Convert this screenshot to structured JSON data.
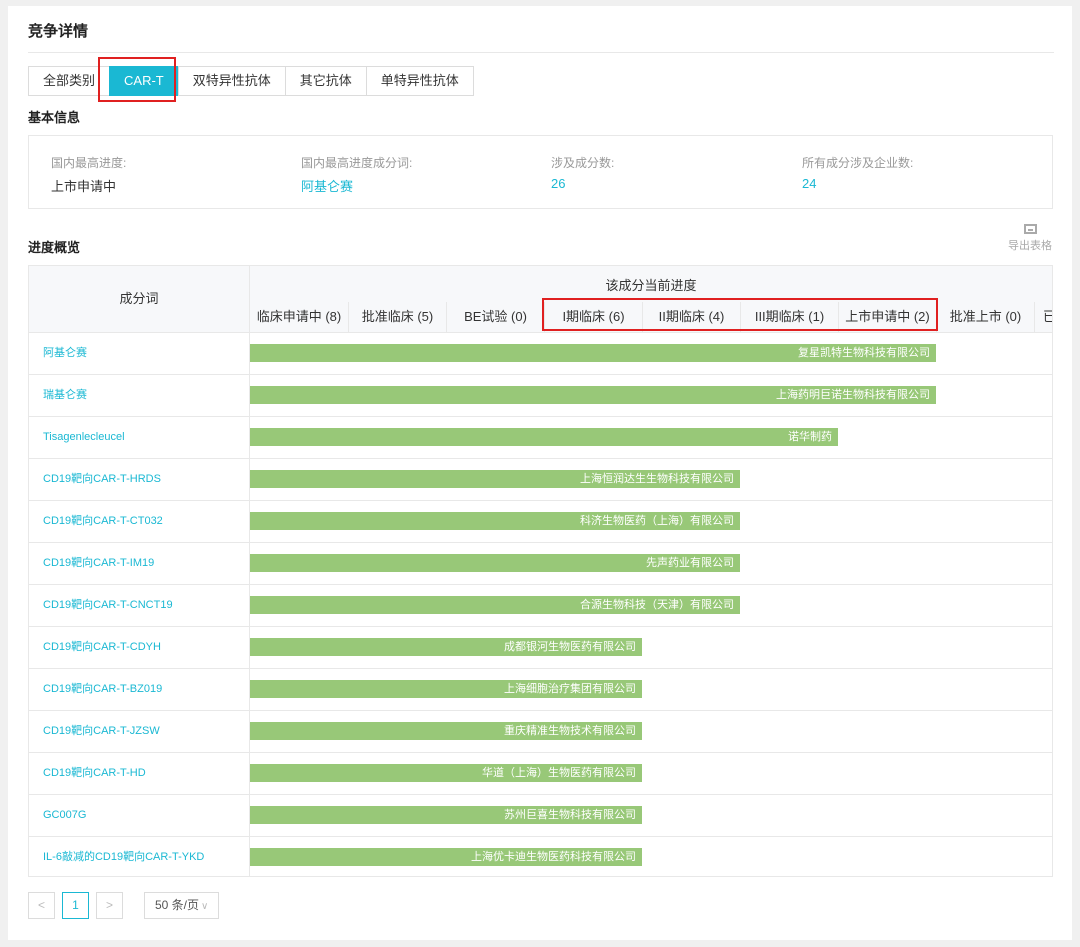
{
  "page": {
    "title": "竞争详情"
  },
  "tabs": [
    {
      "label": "全部类别",
      "active": false
    },
    {
      "label": "CAR-T",
      "active": true
    },
    {
      "label": "双特异性抗体",
      "active": false
    },
    {
      "label": "其它抗体",
      "active": false
    },
    {
      "label": "单特异性抗体",
      "active": false
    }
  ],
  "basic_info": {
    "title": "基本信息",
    "items": [
      {
        "label": "国内最高进度:",
        "value": "上市申请中",
        "link": false
      },
      {
        "label": "国内最高进度成分词:",
        "value": "阿基仑赛",
        "link": true
      },
      {
        "label": "涉及成分数:",
        "value": "26",
        "link": true
      },
      {
        "label": "所有成分涉及企业数:",
        "value": "24",
        "link": true
      }
    ]
  },
  "progress": {
    "title": "进度概览",
    "export_label": "导出表格",
    "export_icon": "table-export-icon",
    "table": {
      "col_ingredient": "成分词",
      "col_group": "该成分当前进度",
      "stages": [
        "临床申请中 (8)",
        "批准临床 (5)",
        "BE试验 (0)",
        "I期临床 (6)",
        "II期临床 (4)",
        "III期临床 (1)",
        "上市申请中 (2)",
        "批准上市 (0)",
        "已"
      ],
      "rows": [
        {
          "name": "阿基仑赛",
          "company": "复星凯特生物科技有限公司",
          "stage_index": 6
        },
        {
          "name": "瑞基仑赛",
          "company": "上海药明巨诺生物科技有限公司",
          "stage_index": 6
        },
        {
          "name": "Tisagenlecleucel",
          "company": "诺华制药",
          "stage_index": 5
        },
        {
          "name": "CD19靶向CAR-T-HRDS",
          "company": "上海恒润达生生物科技有限公司",
          "stage_index": 4
        },
        {
          "name": "CD19靶向CAR-T-CT032",
          "company": "科济生物医药（上海）有限公司",
          "stage_index": 4
        },
        {
          "name": "CD19靶向CAR-T-IM19",
          "company": "先声药业有限公司",
          "stage_index": 4
        },
        {
          "name": "CD19靶向CAR-T-CNCT19",
          "company": "合源生物科技（天津）有限公司",
          "stage_index": 4
        },
        {
          "name": "CD19靶向CAR-T-CDYH",
          "company": "成都银河生物医药有限公司",
          "stage_index": 3
        },
        {
          "name": "CD19靶向CAR-T-BZ019",
          "company": "上海细胞治疗集团有限公司",
          "stage_index": 3
        },
        {
          "name": "CD19靶向CAR-T-JZSW",
          "company": "重庆精准生物技术有限公司",
          "stage_index": 3
        },
        {
          "name": "CD19靶向CAR-T-HD",
          "company": "华道（上海）生物医药有限公司",
          "stage_index": 3
        },
        {
          "name": "GC007G",
          "company": "苏州巨喜生物科技有限公司",
          "stage_index": 3
        },
        {
          "name": "IL-6敲减的CD19靶向CAR-T-YKD",
          "company": "上海优卡迪生物医药科技有限公司",
          "stage_index": 3
        }
      ]
    }
  },
  "pagination": {
    "prev": "<",
    "current": "1",
    "next": ">",
    "page_size": "50 条/页"
  },
  "colors": {
    "accent": "#1ab8d3",
    "bar": "#98c878",
    "highlight": "#e02020"
  }
}
